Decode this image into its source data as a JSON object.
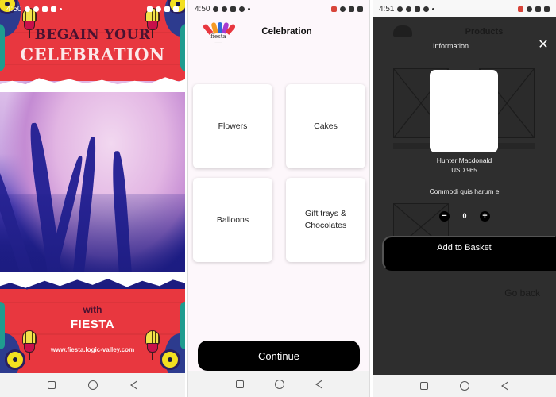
{
  "screens": [
    {
      "id": "splash",
      "status_bar": {
        "time": "4:50"
      },
      "heading_line1": "BEGAIN YOUR",
      "heading_line2": "CELEBRATION",
      "with_text": "with",
      "brand": "FIESTA",
      "website": "www.fiesta.logic-valley.com",
      "colors": {
        "background": "#e8373f",
        "heading_dark": "#4a1230"
      }
    },
    {
      "id": "celebration",
      "status_bar": {
        "time": "4:50"
      },
      "logo_text": "fiesta",
      "title": "Celebration",
      "categories": [
        {
          "label": "Flowers"
        },
        {
          "label": "Cakes"
        },
        {
          "label": "Balloons"
        },
        {
          "label": "Gift trays & Chocolates"
        }
      ],
      "continue_label": "Continue"
    },
    {
      "id": "products",
      "status_bar": {
        "time": "4:51"
      },
      "background_title": "Products",
      "modal": {
        "title": "Information",
        "close_icon": "close-icon",
        "product_name": "Hunter Macdonald",
        "price": "USD 965",
        "description": "Commodi quis harum e",
        "quantity": "0",
        "decrement_label": "−",
        "increment_label": "+",
        "add_to_basket_label": "Add to Basket"
      },
      "go_back_label": "Go back"
    }
  ],
  "nav_icons": [
    "recents-icon",
    "home-icon",
    "back-icon"
  ]
}
